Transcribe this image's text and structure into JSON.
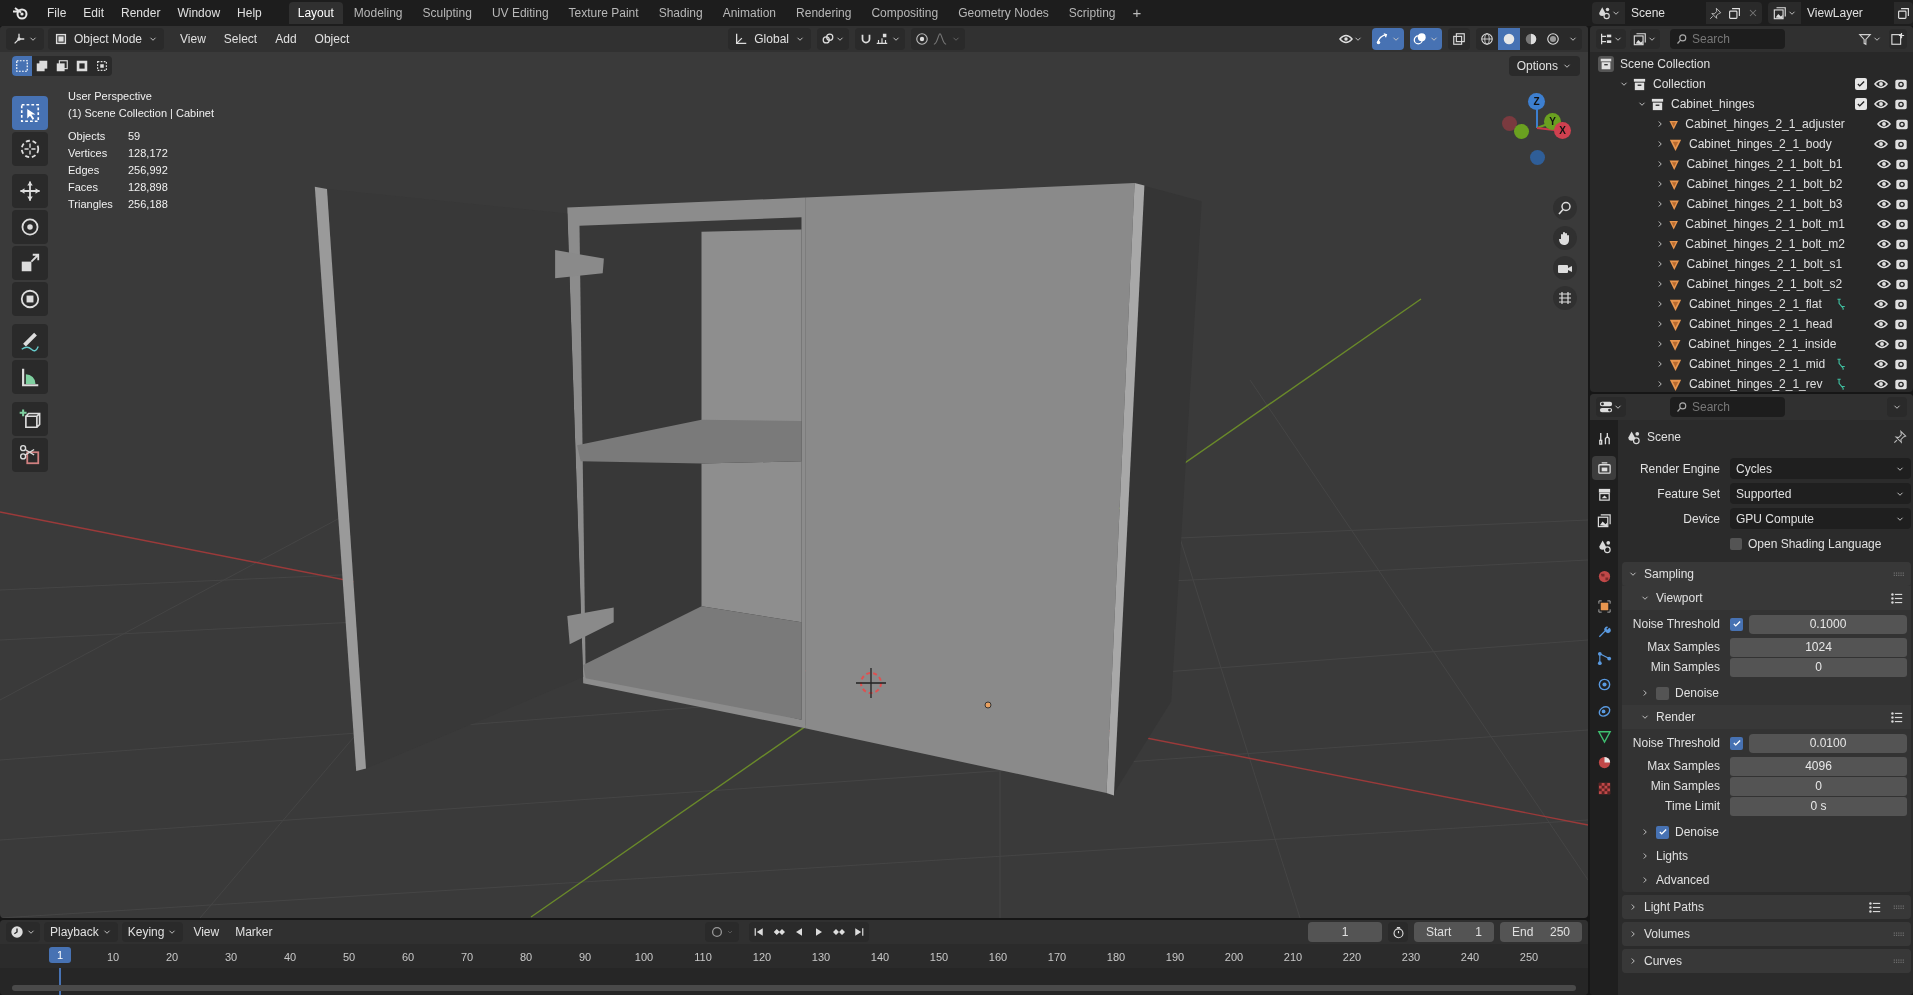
{
  "top_bar": {
    "menus": [
      "File",
      "Edit",
      "Render",
      "Window",
      "Help"
    ],
    "workspaces": [
      {
        "label": "Layout",
        "selected": true
      },
      {
        "label": "Modeling",
        "selected": false
      },
      {
        "label": "Sculpting",
        "selected": false
      },
      {
        "label": "UV Editing",
        "selected": false
      },
      {
        "label": "Texture Paint",
        "selected": false
      },
      {
        "label": "Shading",
        "selected": false
      },
      {
        "label": "Animation",
        "selected": false
      },
      {
        "label": "Rendering",
        "selected": false
      },
      {
        "label": "Compositing",
        "selected": false
      },
      {
        "label": "Geometry Nodes",
        "selected": false
      },
      {
        "label": "Scripting",
        "selected": false
      }
    ],
    "add_workspace": "+",
    "scene": "Scene",
    "view_layer": "ViewLayer"
  },
  "viewport": {
    "mode": "Object Mode",
    "menus": [
      "View",
      "Select",
      "Add",
      "Object"
    ],
    "orientation": "Global",
    "options": "Options",
    "select_modes": [
      {
        "selected": true
      },
      {
        "selected": false
      },
      {
        "selected": false
      },
      {
        "selected": false
      },
      {
        "selected": false
      }
    ],
    "gizmos_on": true,
    "overlays_on": true,
    "shading_modes": [
      {
        "selected": false
      },
      {
        "selected": true
      },
      {
        "selected": false
      },
      {
        "selected": false
      }
    ],
    "title": "User Perspective",
    "collection": "(1) Scene Collection | Cabinet",
    "stats": [
      {
        "label": "Objects",
        "value": "59"
      },
      {
        "label": "Vertices",
        "value": "128,172"
      },
      {
        "label": "Edges",
        "value": "256,992"
      },
      {
        "label": "Faces",
        "value": "128,898"
      },
      {
        "label": "Triangles",
        "value": "256,188"
      }
    ],
    "tools": [
      {
        "selected": true
      },
      {
        "selected": false
      },
      {
        "selected": false
      },
      {
        "selected": false
      },
      {
        "selected": false
      },
      {
        "selected": false
      },
      {
        "selected": false
      },
      {
        "selected": false
      },
      {
        "selected": false
      },
      {
        "selected": false
      }
    ],
    "gizmo_axes": [
      "Z",
      "Y",
      "X"
    ]
  },
  "outliner": {
    "search": {
      "placeholder": "Search"
    },
    "tree": [
      {
        "kind": "scene_collection",
        "label": "Scene Collection",
        "children": [
          {
            "kind": "collection",
            "label": "Collection",
            "expanded": true,
            "checked": true,
            "children": [
              {
                "kind": "collection",
                "label": "Cabinet_hinges",
                "expanded": true,
                "checked": true,
                "children": [
                  {
                    "kind": "mesh",
                    "label": "Cabinet_hinges_2_1_adjuster",
                    "expanded": false,
                    "hooked": false
                  },
                  {
                    "kind": "mesh",
                    "label": "Cabinet_hinges_2_1_body",
                    "expanded": false,
                    "hooked": false
                  },
                  {
                    "kind": "mesh",
                    "label": "Cabinet_hinges_2_1_bolt_b1",
                    "expanded": false,
                    "hooked": false
                  },
                  {
                    "kind": "mesh",
                    "label": "Cabinet_hinges_2_1_bolt_b2",
                    "expanded": false,
                    "hooked": false
                  },
                  {
                    "kind": "mesh",
                    "label": "Cabinet_hinges_2_1_bolt_b3",
                    "expanded": false,
                    "hooked": false
                  },
                  {
                    "kind": "mesh",
                    "label": "Cabinet_hinges_2_1_bolt_m1",
                    "expanded": false,
                    "hooked": false
                  },
                  {
                    "kind": "mesh",
                    "label": "Cabinet_hinges_2_1_bolt_m2",
                    "expanded": false,
                    "hooked": false
                  },
                  {
                    "kind": "mesh",
                    "label": "Cabinet_hinges_2_1_bolt_s1",
                    "expanded": false,
                    "hooked": false
                  },
                  {
                    "kind": "mesh",
                    "label": "Cabinet_hinges_2_1_bolt_s2",
                    "expanded": false,
                    "hooked": false
                  },
                  {
                    "kind": "mesh",
                    "label": "Cabinet_hinges_2_1_flat",
                    "expanded": false,
                    "hooked": true
                  },
                  {
                    "kind": "mesh",
                    "label": "Cabinet_hinges_2_1_head",
                    "expanded": false,
                    "hooked": false
                  },
                  {
                    "kind": "mesh",
                    "label": "Cabinet_hinges_2_1_inside",
                    "expanded": false,
                    "hooked": false
                  },
                  {
                    "kind": "mesh",
                    "label": "Cabinet_hinges_2_1_mid",
                    "expanded": false,
                    "hooked": true
                  },
                  {
                    "kind": "mesh",
                    "label": "Cabinet_hinges_2_1_rev",
                    "expanded": false,
                    "hooked": true
                  }
                ]
              }
            ]
          }
        ]
      }
    ]
  },
  "properties": {
    "search": {
      "placeholder": "Search"
    },
    "tabs": [
      {
        "selected": false
      },
      {
        "selected": true
      },
      {
        "selected": false
      },
      {
        "selected": false
      },
      {
        "selected": false
      },
      {
        "selected": false
      },
      {
        "selected": false
      },
      {
        "selected": false
      },
      {
        "selected": false
      },
      {
        "selected": false
      },
      {
        "selected": false
      },
      {
        "selected": false
      },
      {
        "selected": false
      },
      {
        "selected": false
      }
    ],
    "context": "Scene",
    "fields": [
      {
        "label": "Render Engine",
        "value": "Cycles"
      },
      {
        "label": "Feature Set",
        "value": "Supported"
      },
      {
        "label": "Device",
        "value": "GPU Compute"
      }
    ],
    "osl": {
      "label": "Open Shading Language",
      "checked": false
    },
    "panels": [
      {
        "label": "Sampling",
        "expanded": true,
        "presets": false,
        "children": [
          {
            "label": "Viewport",
            "expanded": true,
            "presets": true,
            "rows": [
              {
                "kind": "threshold",
                "label": "Noise Threshold",
                "checked": true,
                "value": "0.1000"
              },
              {
                "kind": "number",
                "label": "Max Samples",
                "value": "1024"
              },
              {
                "kind": "number",
                "label": "Min Samples",
                "value": "0"
              }
            ]
          },
          {
            "label": "Denoise",
            "expanded": false,
            "presets": false,
            "checked": false
          },
          {
            "label": "Render",
            "expanded": true,
            "presets": true,
            "rows": [
              {
                "kind": "threshold",
                "label": "Noise Threshold",
                "checked": true,
                "value": "0.0100"
              },
              {
                "kind": "number",
                "label": "Max Samples",
                "value": "4096"
              },
              {
                "kind": "number",
                "label": "Min Samples",
                "value": "0"
              },
              {
                "kind": "number",
                "label": "Time Limit",
                "value": "0 s"
              }
            ]
          },
          {
            "label": "Denoise",
            "expanded": false,
            "presets": false,
            "checked": true
          },
          {
            "label": "Lights",
            "expanded": false,
            "presets": false
          },
          {
            "label": "Advanced",
            "expanded": false,
            "presets": false
          }
        ]
      },
      {
        "label": "Light Paths",
        "expanded": false,
        "presets": true
      },
      {
        "label": "Volumes",
        "expanded": false,
        "presets": false
      },
      {
        "label": "Curves",
        "expanded": false,
        "presets": false
      }
    ]
  },
  "timeline": {
    "menus": [
      "Playback",
      "Keying",
      "View",
      "Marker"
    ],
    "current_frame": "1",
    "start_label": "Start",
    "start": "1",
    "end_label": "End",
    "end": "250",
    "playhead": "1",
    "ruler": [
      "10",
      "20",
      "30",
      "40",
      "50",
      "60",
      "70",
      "80",
      "90",
      "100",
      "110",
      "120",
      "130",
      "140",
      "150",
      "160",
      "170",
      "180",
      "190",
      "200",
      "210",
      "220",
      "230",
      "240",
      "250"
    ]
  }
}
